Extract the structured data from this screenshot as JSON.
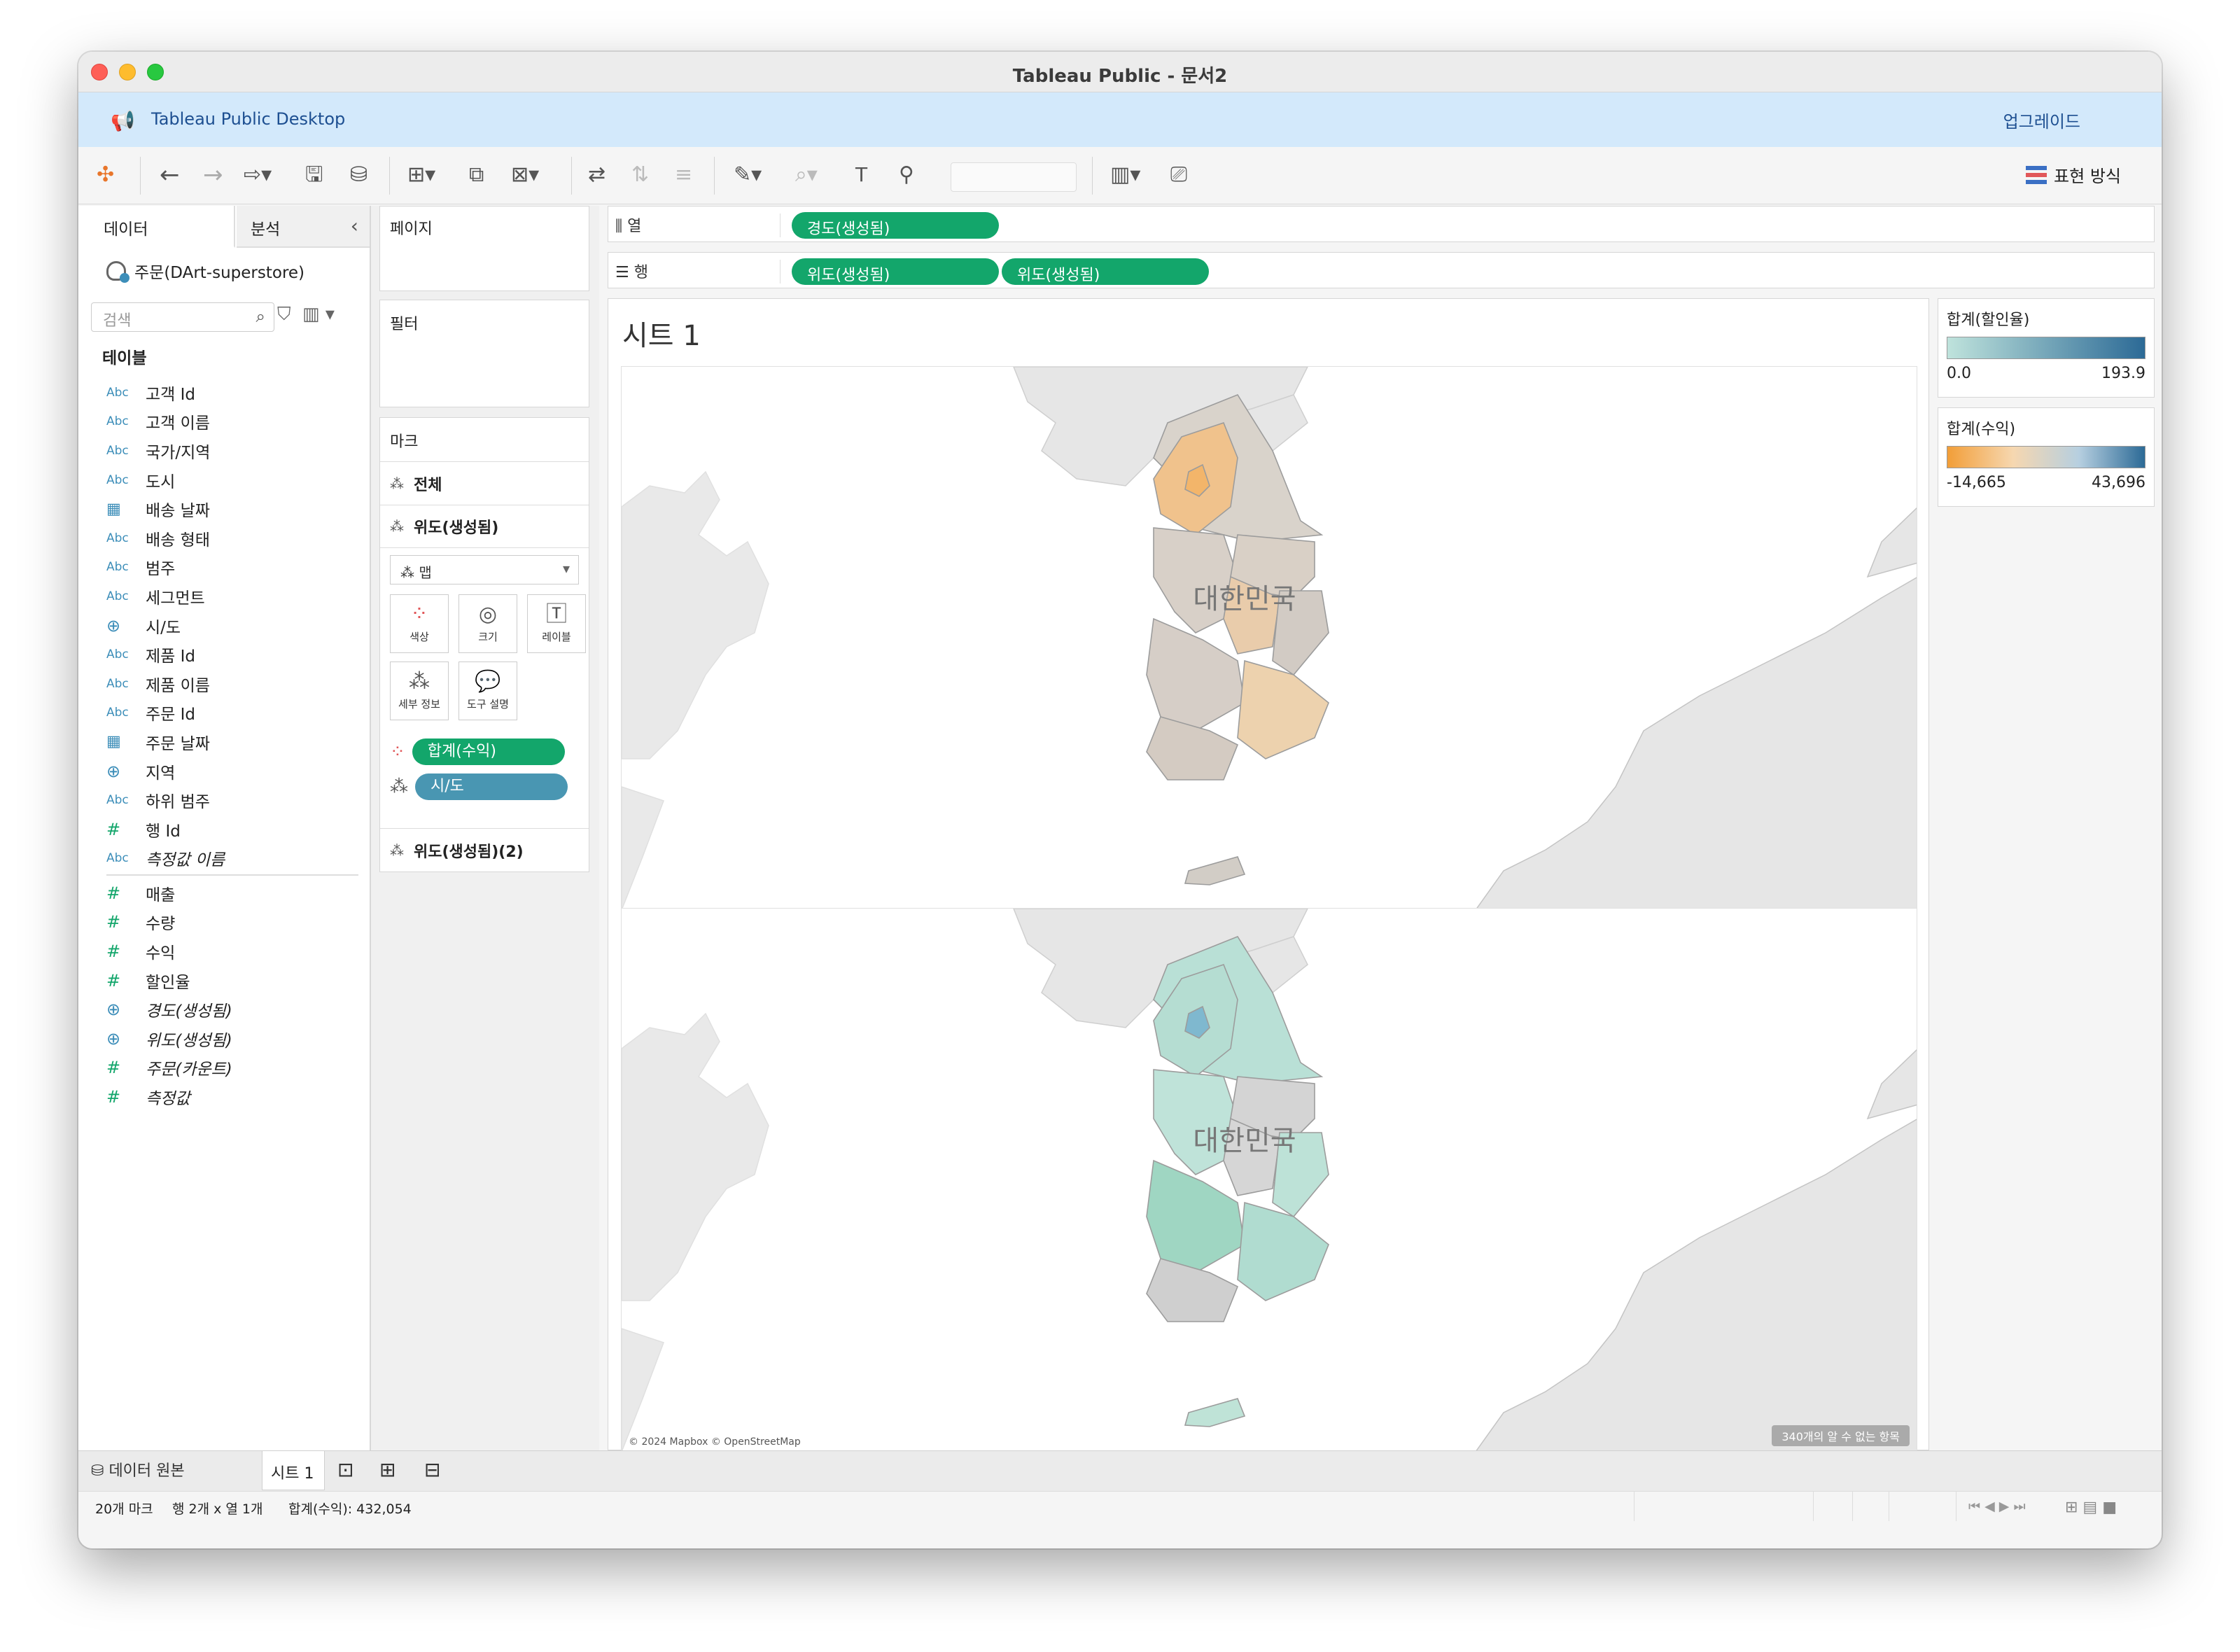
{
  "window": {
    "title": "Tableau Public - 문서2"
  },
  "banner": {
    "text": "Tableau Public Desktop",
    "upgrade": "업그레이드"
  },
  "toolbar": {
    "show_me": "표현 방식"
  },
  "left": {
    "tab_data": "데이터",
    "tab_analysis": "분석",
    "datasource": "주문(DArt-superstore)",
    "search_placeholder": "검색",
    "tables_heading": "테이블",
    "dims": [
      {
        "icon": "Abc",
        "label": "고객 Id"
      },
      {
        "icon": "Abc",
        "label": "고객 이름"
      },
      {
        "icon": "Abc",
        "label": "국가/지역"
      },
      {
        "icon": "Abc",
        "label": "도시"
      },
      {
        "icon": "cal",
        "label": "배송 날짜"
      },
      {
        "icon": "Abc",
        "label": "배송 형태"
      },
      {
        "icon": "Abc",
        "label": "범주"
      },
      {
        "icon": "Abc",
        "label": "세그먼트"
      },
      {
        "icon": "geo",
        "label": "시/도"
      },
      {
        "icon": "Abc",
        "label": "제품 Id"
      },
      {
        "icon": "Abc",
        "label": "제품 이름"
      },
      {
        "icon": "Abc",
        "label": "주문 Id"
      },
      {
        "icon": "cal",
        "label": "주문 날짜"
      },
      {
        "icon": "geo",
        "label": "지역"
      },
      {
        "icon": "Abc",
        "label": "하위 범주"
      },
      {
        "icon": "#",
        "label": "행 Id"
      },
      {
        "icon": "Abc",
        "label": "측정값 이름",
        "italic": true
      }
    ],
    "measures": [
      {
        "icon": "#",
        "label": "매출"
      },
      {
        "icon": "#",
        "label": "수량"
      },
      {
        "icon": "#",
        "label": "수익"
      },
      {
        "icon": "#",
        "label": "할인율"
      },
      {
        "icon": "geo",
        "label": "경도(생성됨)",
        "italic": true
      },
      {
        "icon": "geo",
        "label": "위도(생성됨)",
        "italic": true
      },
      {
        "icon": "#",
        "label": "주문(카운트)",
        "italic": true
      },
      {
        "icon": "#",
        "label": "측정값",
        "italic": true
      }
    ]
  },
  "cards": {
    "pages": "페이지",
    "filters": "필터",
    "marks": "마크",
    "marks_all": "전체",
    "marks_lat1": "위도(생성됨)",
    "marks_type": "맵",
    "btn_color": "색상",
    "btn_size": "크기",
    "btn_label": "레이블",
    "btn_detail": "세부 정보",
    "btn_tooltip": "도구 설명",
    "pill_profit": "합계(수익)",
    "pill_sido": "시/도",
    "marks_lat2": "위도(생성됨)(2)"
  },
  "shelves": {
    "columns_label": "열",
    "rows_label": "행",
    "col_pill": "경도(생성됨)",
    "row_pill1": "위도(생성됨)",
    "row_pill2": "위도(생성됨)"
  },
  "sheet": {
    "title": "시트 1",
    "map_label": "대한민국",
    "attribution": "© 2024 Mapbox © OpenStreetMap",
    "unknown": "340개의 알 수 없는 항목"
  },
  "legends": {
    "discount": {
      "title": "합계(할인율)",
      "min": "0.0",
      "max": "193.9",
      "colors": [
        "#bfe3dc",
        "#2c6a96"
      ]
    },
    "profit": {
      "title": "합계(수익)",
      "min": "-14,665",
      "max": "43,696",
      "colors": [
        "#f29e38",
        "#f6d7b0",
        "#b6cfe0",
        "#2c6a96"
      ]
    }
  },
  "bottom": {
    "datasource_tab": "데이터 원본",
    "sheet_tab": "시트 1"
  },
  "status": {
    "marks": "20개 마크",
    "dims": "행 2개 x 열 1개",
    "sum": "합계(수익): 432,054"
  }
}
